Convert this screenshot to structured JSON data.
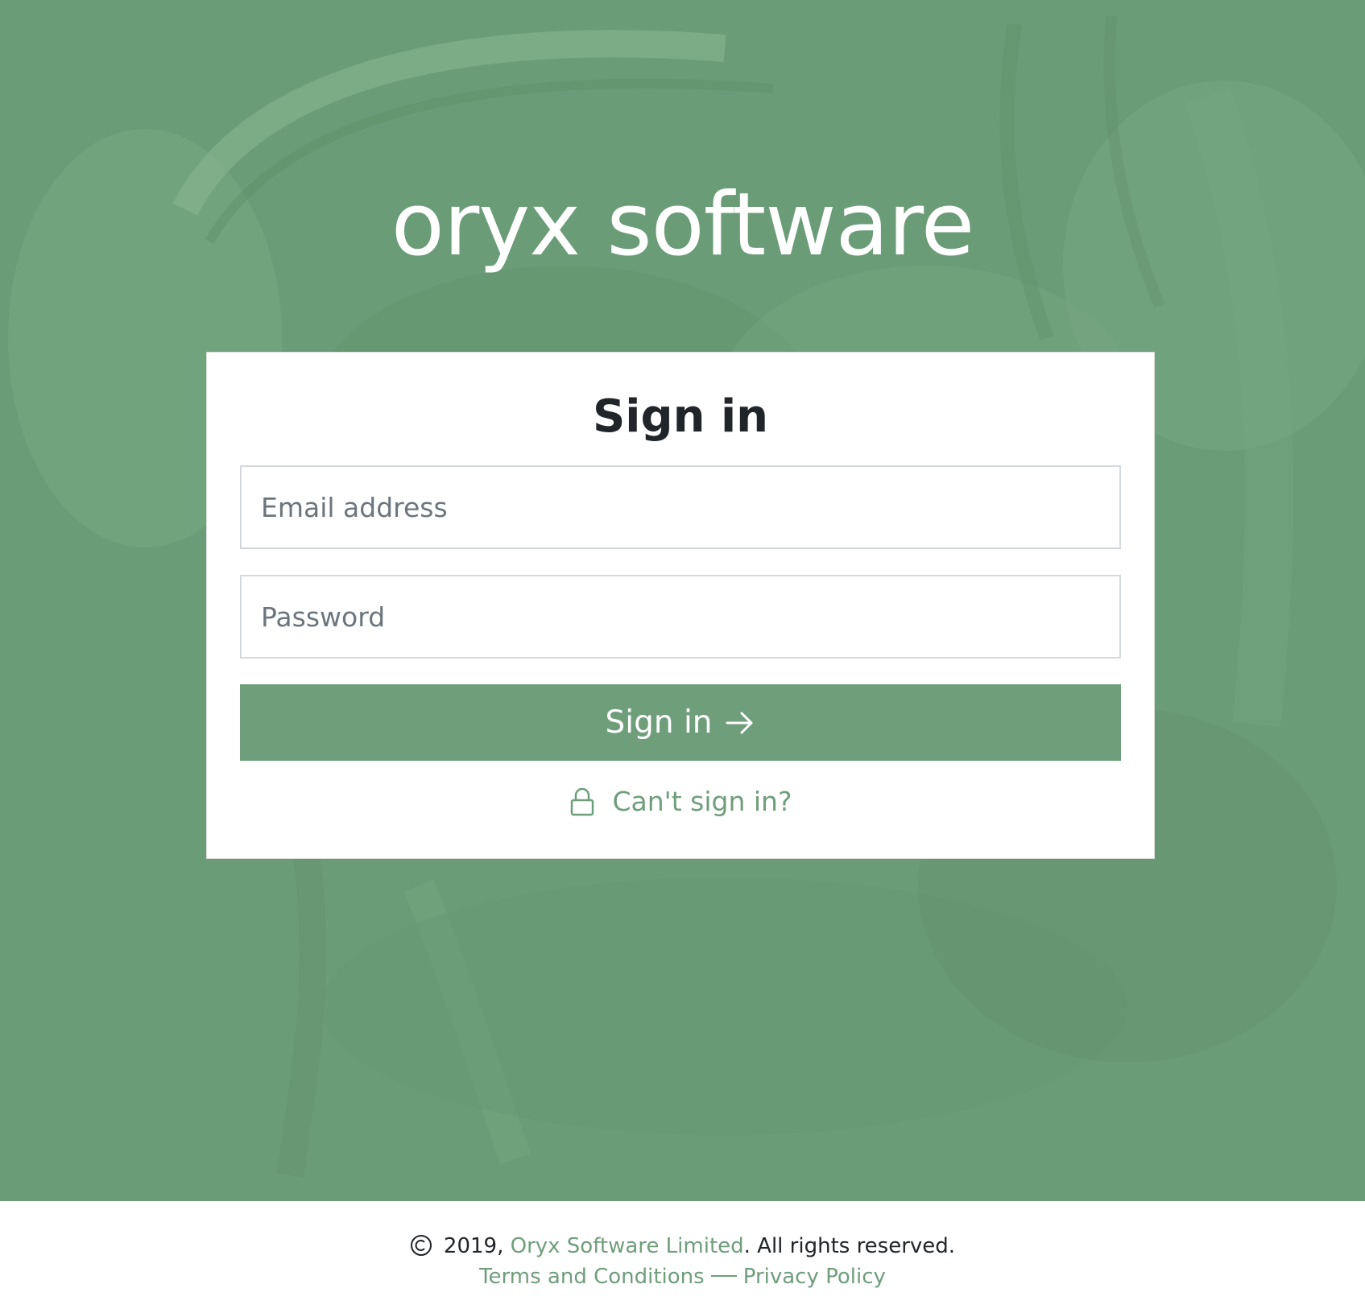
{
  "brand": {
    "name": "oryx software"
  },
  "signin": {
    "title": "Sign in",
    "email_placeholder": "Email address",
    "password_placeholder": "Password",
    "submit_label": "Sign in",
    "help_link": "Can't sign in?"
  },
  "footer": {
    "copyright_year": "2019,",
    "company_link": "Oryx Software Limited",
    "rights": ". All rights reserved.",
    "terms_link": "Terms and Conditions",
    "privacy_link": "Privacy Policy"
  },
  "icons": {
    "submit": "arrow-right-icon",
    "help": "lock-icon",
    "copyright": "copyright-icon",
    "background": "antelope-photo"
  },
  "colors": {
    "hero_green": "#6a9d77",
    "accent": "#6f9e7b",
    "text_dark": "#212529",
    "placeholder": "#6c757d"
  }
}
